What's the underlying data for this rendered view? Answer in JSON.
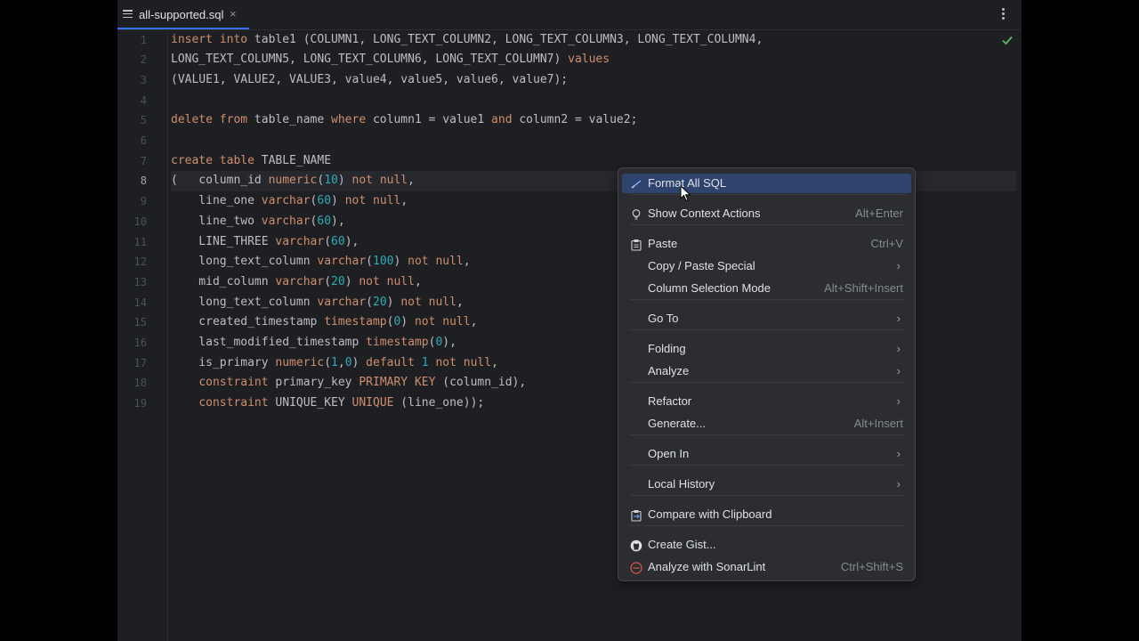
{
  "tab": {
    "title": "all-supported.sql",
    "close": "×"
  },
  "editor": {
    "line_numbers": [
      "1",
      "2",
      "3",
      "4",
      "5",
      "6",
      "7",
      "8",
      "9",
      "10",
      "11",
      "12",
      "13",
      "14",
      "15",
      "16",
      "17",
      "18",
      "19"
    ],
    "lines": [
      [
        [
          "k",
          "insert into"
        ],
        [
          "i",
          " table1 (COLUMN1, LONG_TEXT_COLUMN2, LONG_TEXT_COLUMN3, LONG_TEXT_COLUMN4,"
        ]
      ],
      [
        [
          "i",
          "LONG_TEXT_COLUMN5, LONG_TEXT_COLUMN6, LONG_TEXT_COLUMN7) "
        ],
        [
          "k",
          "values"
        ]
      ],
      [
        [
          "i",
          "(VALUE1, VALUE2, VALUE3, value4, value5, value6, value7);"
        ]
      ],
      [],
      [
        [
          "k",
          "delete from"
        ],
        [
          "i",
          " table_name "
        ],
        [
          "k",
          "where"
        ],
        [
          "i",
          " column1 = value1 "
        ],
        [
          "k",
          "and"
        ],
        [
          "i",
          " column2 = value2;"
        ]
      ],
      [],
      [
        [
          "k",
          "create table"
        ],
        [
          "i",
          " TABLE_NAME"
        ]
      ],
      [
        [
          "i",
          "(   column_id "
        ],
        [
          "k",
          "numeric"
        ],
        [
          "i",
          "("
        ],
        [
          "n",
          "10"
        ],
        [
          "i",
          ") "
        ],
        [
          "k",
          "not null"
        ],
        [
          "i",
          ","
        ]
      ],
      [
        [
          "i",
          "    line_one "
        ],
        [
          "k",
          "varchar"
        ],
        [
          "i",
          "("
        ],
        [
          "n",
          "60"
        ],
        [
          "i",
          ") "
        ],
        [
          "k",
          "not null"
        ],
        [
          "i",
          ","
        ]
      ],
      [
        [
          "i",
          "    line_two "
        ],
        [
          "k",
          "varchar"
        ],
        [
          "i",
          "("
        ],
        [
          "n",
          "60"
        ],
        [
          "i",
          "),"
        ]
      ],
      [
        [
          "i",
          "    LINE_THREE "
        ],
        [
          "k",
          "varchar"
        ],
        [
          "i",
          "("
        ],
        [
          "n",
          "60"
        ],
        [
          "i",
          "),"
        ]
      ],
      [
        [
          "i",
          "    long_text_column "
        ],
        [
          "k",
          "varchar"
        ],
        [
          "i",
          "("
        ],
        [
          "n",
          "100"
        ],
        [
          "i",
          ") "
        ],
        [
          "k",
          "not null"
        ],
        [
          "i",
          ","
        ]
      ],
      [
        [
          "i",
          "    mid_column "
        ],
        [
          "k",
          "varchar"
        ],
        [
          "i",
          "("
        ],
        [
          "n",
          "20"
        ],
        [
          "i",
          ") "
        ],
        [
          "k",
          "not null"
        ],
        [
          "i",
          ","
        ]
      ],
      [
        [
          "i",
          "    long_text_column "
        ],
        [
          "k",
          "varchar"
        ],
        [
          "i",
          "("
        ],
        [
          "n",
          "20"
        ],
        [
          "i",
          ") "
        ],
        [
          "k",
          "not null"
        ],
        [
          "i",
          ","
        ]
      ],
      [
        [
          "i",
          "    created_timestamp "
        ],
        [
          "k",
          "timestamp"
        ],
        [
          "i",
          "("
        ],
        [
          "n",
          "0"
        ],
        [
          "i",
          ") "
        ],
        [
          "k",
          "not null"
        ],
        [
          "i",
          ","
        ]
      ],
      [
        [
          "i",
          "    last_modified_timestamp "
        ],
        [
          "k",
          "timestamp"
        ],
        [
          "i",
          "("
        ],
        [
          "n",
          "0"
        ],
        [
          "i",
          "),"
        ]
      ],
      [
        [
          "i",
          "    is_primary "
        ],
        [
          "k",
          "numeric"
        ],
        [
          "i",
          "("
        ],
        [
          "n",
          "1"
        ],
        [
          "i",
          ","
        ],
        [
          "n",
          "0"
        ],
        [
          "i",
          ") "
        ],
        [
          "k",
          "default"
        ],
        [
          "i",
          " "
        ],
        [
          "n",
          "1"
        ],
        [
          "i",
          " "
        ],
        [
          "k",
          "not null"
        ],
        [
          "i",
          ","
        ]
      ],
      [
        [
          "i",
          "    "
        ],
        [
          "k",
          "constraint"
        ],
        [
          "i",
          " primary_key "
        ],
        [
          "k",
          "PRIMARY KEY"
        ],
        [
          "i",
          " (column_id),"
        ]
      ],
      [
        [
          "i",
          "    "
        ],
        [
          "k",
          "constraint"
        ],
        [
          "i",
          " UNIQUE_KEY "
        ],
        [
          "k",
          "UNIQUE"
        ],
        [
          "i",
          " (line_one));"
        ]
      ]
    ]
  },
  "context_menu": {
    "items": [
      {
        "label": "Format All SQL",
        "shortcut": "",
        "icon": "sql-format-icon",
        "submenu": false
      },
      {
        "label": "Show Context Actions",
        "shortcut": "Alt+Enter",
        "icon": "lightbulb-icon",
        "submenu": false
      },
      {
        "label": "Paste",
        "shortcut": "Ctrl+V",
        "icon": "clipboard-icon",
        "submenu": false
      },
      {
        "label": "Copy / Paste Special",
        "shortcut": "",
        "icon": "",
        "submenu": true
      },
      {
        "label": "Column Selection Mode",
        "shortcut": "Alt+Shift+Insert",
        "icon": "",
        "submenu": false
      },
      {
        "label": "Go To",
        "shortcut": "",
        "icon": "",
        "submenu": true
      },
      {
        "label": "Folding",
        "shortcut": "",
        "icon": "",
        "submenu": true
      },
      {
        "label": "Analyze",
        "shortcut": "",
        "icon": "",
        "submenu": true
      },
      {
        "label": "Refactor",
        "shortcut": "",
        "icon": "",
        "submenu": true
      },
      {
        "label": "Generate...",
        "shortcut": "Alt+Insert",
        "icon": "",
        "submenu": false
      },
      {
        "label": "Open In",
        "shortcut": "",
        "icon": "",
        "submenu": true
      },
      {
        "label": "Local History",
        "shortcut": "",
        "icon": "",
        "submenu": true
      },
      {
        "label": "Compare with Clipboard",
        "shortcut": "",
        "icon": "compare-clipboard-icon",
        "submenu": false
      },
      {
        "label": "Create Gist...",
        "shortcut": "",
        "icon": "github-icon",
        "submenu": false
      },
      {
        "label": "Analyze with SonarLint",
        "shortcut": "Ctrl+Shift+S",
        "icon": "sonarlint-icon",
        "submenu": false
      }
    ],
    "submenu_arrow": "›"
  },
  "colors": {
    "keyword": "#cf8e6d",
    "number": "#2aacb8",
    "identifier": "#bcbec4",
    "selection": "#2e436e",
    "check": "#5fb865"
  }
}
